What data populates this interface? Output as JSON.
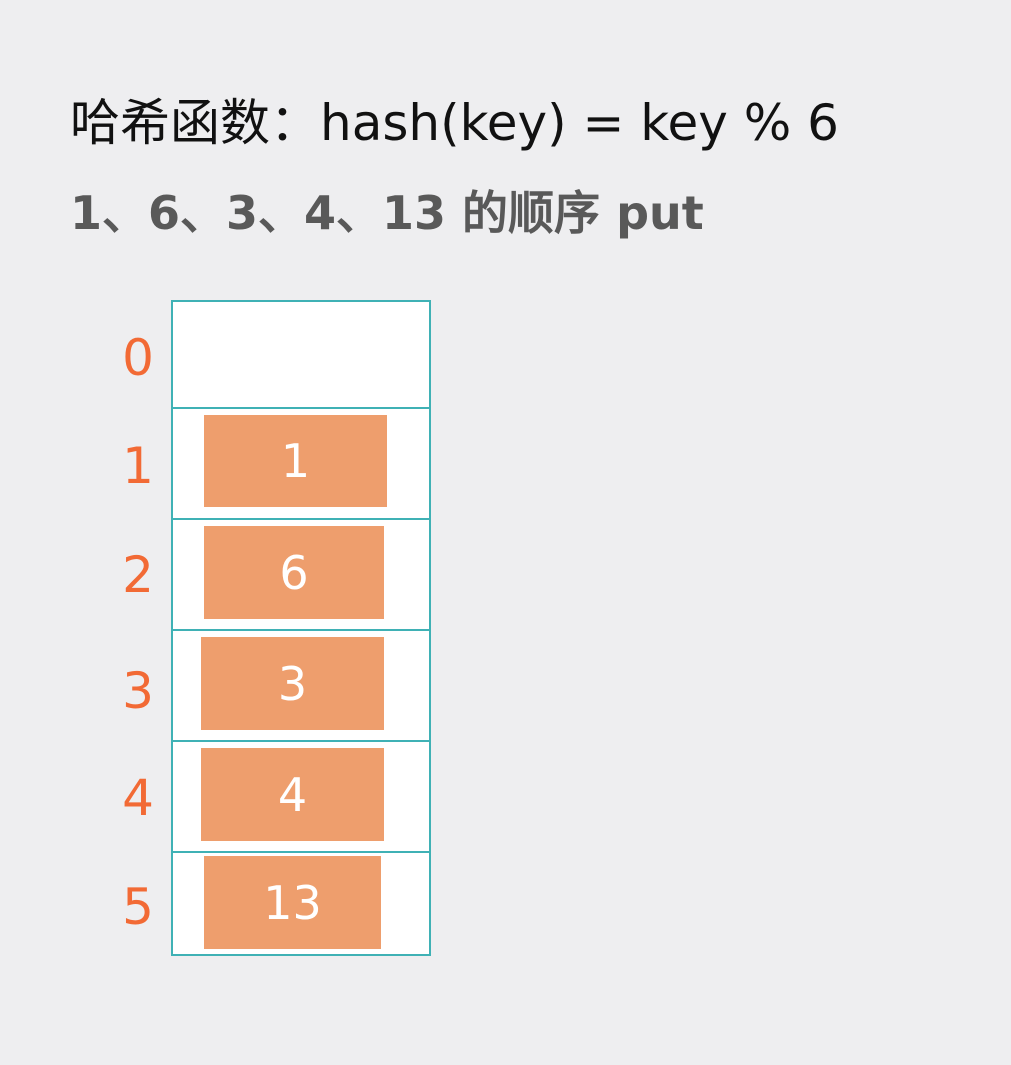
{
  "header": {
    "hash_function": "哈希函数：hash(key) = key % 6",
    "insert_order": "1、6、3、4、13 的顺序 put"
  },
  "table": {
    "border_color": "#3fb1b5",
    "entry_color": "#ee9e6d",
    "index_color": "#f26a35",
    "slots": [
      {
        "index": "0",
        "value": ""
      },
      {
        "index": "1",
        "value": "1"
      },
      {
        "index": "2",
        "value": "6"
      },
      {
        "index": "3",
        "value": "3"
      },
      {
        "index": "4",
        "value": "4"
      },
      {
        "index": "5",
        "value": "13"
      }
    ]
  }
}
